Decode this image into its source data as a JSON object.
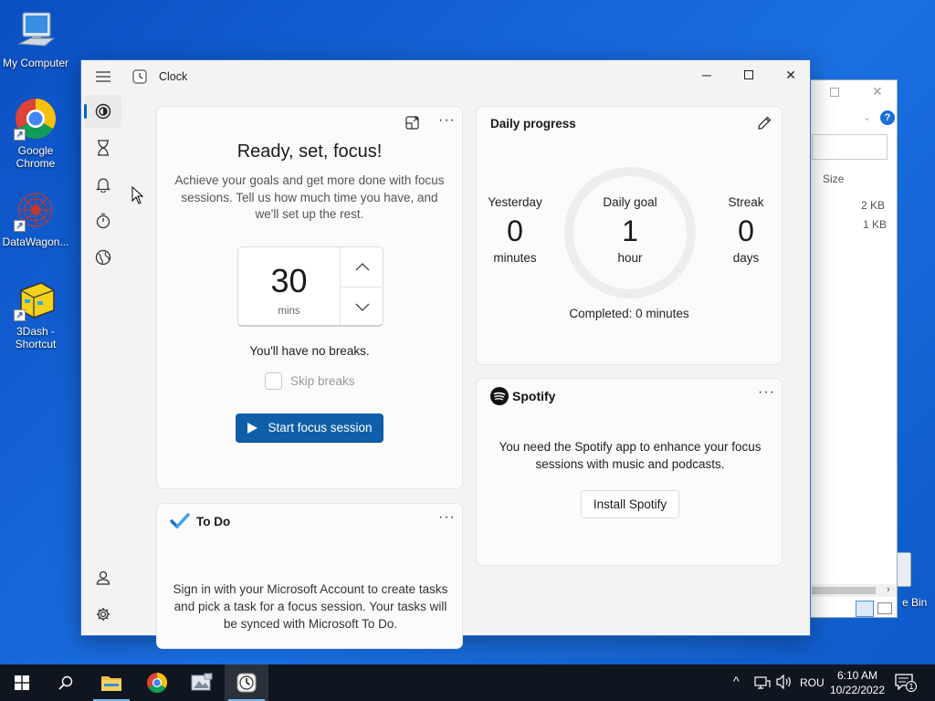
{
  "desktop": {
    "icons": [
      {
        "label": "My Computer"
      },
      {
        "label": "Google Chrome"
      },
      {
        "label": "DataWagon..."
      },
      {
        "label": "3Dash - Shortcut"
      }
    ],
    "recycle_bin_label": "e Bin"
  },
  "explorer_bg": {
    "column_size": "Size",
    "sizes": [
      "2 KB",
      "1 KB"
    ]
  },
  "window": {
    "title": "Clock",
    "minimize": "─",
    "maximize": "☐",
    "close": "✕"
  },
  "nav": {
    "items": [
      "menu-icon",
      "focus-sessions-icon",
      "timer-icon",
      "alarm-icon",
      "stopwatch-icon",
      "world-clock-icon"
    ],
    "bottom": [
      "account-icon",
      "settings-icon"
    ]
  },
  "focus": {
    "title": "Ready, set, focus!",
    "description": "Achieve your goals and get more done with focus sessions. Tell us how much time you have, and we'll set up the rest.",
    "minutes": "30",
    "unit": "mins",
    "breaks_text": "You'll have no breaks.",
    "skip_breaks": "Skip breaks",
    "skip_checked": false,
    "start_label": "Start focus session"
  },
  "todo": {
    "title": "To Do",
    "description": "Sign in with your Microsoft Account to create tasks and pick a task for a focus session. Your tasks will be synced with Microsoft To Do."
  },
  "daily_progress": {
    "title": "Daily progress",
    "yesterday": {
      "label": "Yesterday",
      "value": "0",
      "unit": "minutes"
    },
    "goal": {
      "label": "Daily goal",
      "value": "1",
      "unit": "hour"
    },
    "streak": {
      "label": "Streak",
      "value": "0",
      "unit": "days"
    },
    "completed": "Completed: 0 minutes"
  },
  "spotify": {
    "brand": "Spotify",
    "description": "You need the Spotify app to enhance your focus sessions with music and podcasts.",
    "install_label": "Install Spotify"
  },
  "taskbar": {
    "language": "ROU",
    "time": "6:10 AM",
    "date": "10/22/2022",
    "notification_count": "1"
  },
  "colors": {
    "accent": "#0f5fa8",
    "nav_indicator": "#0067c0",
    "desktop": "#1565d8"
  }
}
